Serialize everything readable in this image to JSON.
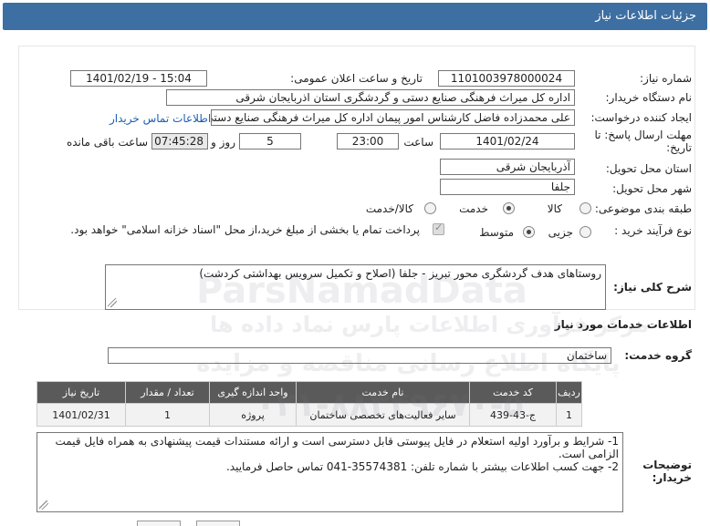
{
  "header": {
    "title": "جزئیات اطلاعات نیاز"
  },
  "fields": {
    "need_number_label": "شماره نیاز:",
    "need_number": "1101003978000024",
    "announce_label": "تاریخ و ساعت اعلان عمومی:",
    "announce_value": "1401/02/19 - 15:04",
    "buyer_label": "نام دستگاه خریدار:",
    "buyer_value": "اداره کل میراث فرهنگی  صنایع دستی و گردشگری استان اذربایجان شرقی",
    "creator_label": "ایجاد کننده درخواست:",
    "creator_value": "علی محمدزاده فاضل کارشناس امور پیمان اداره کل میراث فرهنگی  صنایع دستی",
    "contact_link": "اطلاعات تماس خریدار",
    "deadline_label_1": "مهلت ارسال پاسخ: تا",
    "deadline_label_2": "تاریخ:",
    "deadline_date": "1401/02/24",
    "time_label": "ساعت",
    "deadline_time": "23:00",
    "days_value": "5",
    "days_label": "روز و",
    "remaining_time": "07:45:28",
    "remaining_label": "ساعت باقی مانده",
    "province_label": "استان محل تحویل:",
    "province_value": "آذربایجان شرقی",
    "city_label": "شهر محل تحویل:",
    "city_value": "جلفا",
    "category_label": "طبقه بندی موضوعی:",
    "category_options": [
      "کالا",
      "خدمت",
      "کالا/خدمت"
    ],
    "process_label": "نوع فرآیند خرید :",
    "process_options": [
      "جزیی",
      "متوسط"
    ],
    "payment_note": "پرداخت تمام یا بخشی از مبلغ خرید،از محل \"اسناد خزانه اسلامی\" خواهد بود."
  },
  "description": {
    "label": "شرح کلی نیاز:",
    "text": "روستاهای هدف گردشگری محور تبریز - جلفا (اصلاح و تکمیل سرویس بهداشتی کردشت)"
  },
  "services": {
    "section_title": "اطلاعات خدمات مورد نیاز",
    "group_label": "گروه خدمت:",
    "group_value": "ساختمان",
    "columns": [
      "ردیف",
      "کد خدمت",
      "نام خدمت",
      "واحد اندازه گیری",
      "تعداد / مقدار",
      "تاریخ نیاز"
    ],
    "rows": [
      [
        "1",
        "ج-43-439",
        "سایر فعالیت‌های تخصصی ساختمان",
        "پروژه",
        "1",
        "1401/02/31"
      ]
    ]
  },
  "buyer_notes": {
    "label_1": "توضیحات",
    "label_2": "خریدار:",
    "line1": "1- شرایط و برآورد اولیه استعلام در فایل پیوستی قابل دسترسی است و ارائه مستندات قیمت پیشنهادی به همراه فایل قیمت الزامی است.",
    "line2": "2- جهت کسب اطلاعات بیشتر  با شماره تلفن: 35574381-041  تماس حاصل فرمایید."
  },
  "watermark": {
    "line1": "ParsNamadData",
    "line2": "مرکز فرآوری اطلاعات پارس نماد داده ها",
    "line3": "پایگاه اطلاع رسانی مناقصه و مزایده",
    "line4": "۰۲۱-۸۸۳۴۹۶۷۰-۵"
  }
}
